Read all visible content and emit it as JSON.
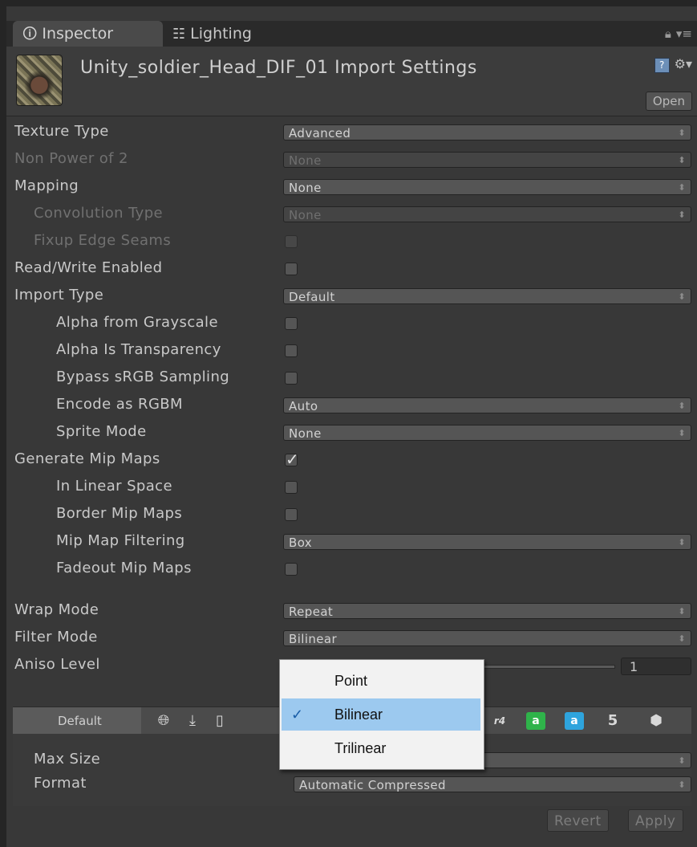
{
  "tabs": {
    "inspector": "Inspector",
    "lighting": "Lighting"
  },
  "header": {
    "title": "Unity_soldier_Head_DIF_01 Import Settings",
    "open_label": "Open"
  },
  "props": {
    "texture_type": {
      "label": "Texture Type",
      "value": "Advanced"
    },
    "non_power_of_2": {
      "label": "Non Power of 2",
      "value": "None"
    },
    "mapping": {
      "label": "Mapping",
      "value": "None"
    },
    "convolution_type": {
      "label": "Convolution Type",
      "value": "None"
    },
    "fixup_edge_seams": {
      "label": "Fixup Edge Seams"
    },
    "read_write_enabled": {
      "label": "Read/Write Enabled"
    },
    "import_type": {
      "label": "Import Type",
      "value": "Default"
    },
    "alpha_from_grayscale": {
      "label": "Alpha from Grayscale"
    },
    "alpha_is_transparency": {
      "label": "Alpha Is Transparency"
    },
    "bypass_srgb": {
      "label": "Bypass sRGB Sampling"
    },
    "encode_rgbm": {
      "label": "Encode as RGBM",
      "value": "Auto"
    },
    "sprite_mode": {
      "label": "Sprite Mode",
      "value": "None"
    },
    "generate_mip_maps": {
      "label": "Generate Mip Maps",
      "checked": true
    },
    "in_linear_space": {
      "label": "In Linear Space"
    },
    "border_mip_maps": {
      "label": "Border Mip Maps"
    },
    "mip_map_filtering": {
      "label": "Mip Map Filtering",
      "value": "Box"
    },
    "fadeout_mip_maps": {
      "label": "Fadeout Mip Maps"
    },
    "wrap_mode": {
      "label": "Wrap Mode",
      "value": "Repeat"
    },
    "filter_mode": {
      "label": "Filter Mode",
      "value": "Bilinear"
    },
    "aniso_level": {
      "label": "Aniso Level",
      "value": "1"
    }
  },
  "platform": {
    "default_tab": "Default",
    "ps4_label": "r4",
    "max_size_label": "Max Size",
    "format_label": "Format",
    "format_value": "Automatic Compressed"
  },
  "buttons": {
    "revert": "Revert",
    "apply": "Apply"
  },
  "filter_popup": {
    "options": [
      "Point",
      "Bilinear",
      "Trilinear"
    ],
    "selected": "Bilinear"
  }
}
